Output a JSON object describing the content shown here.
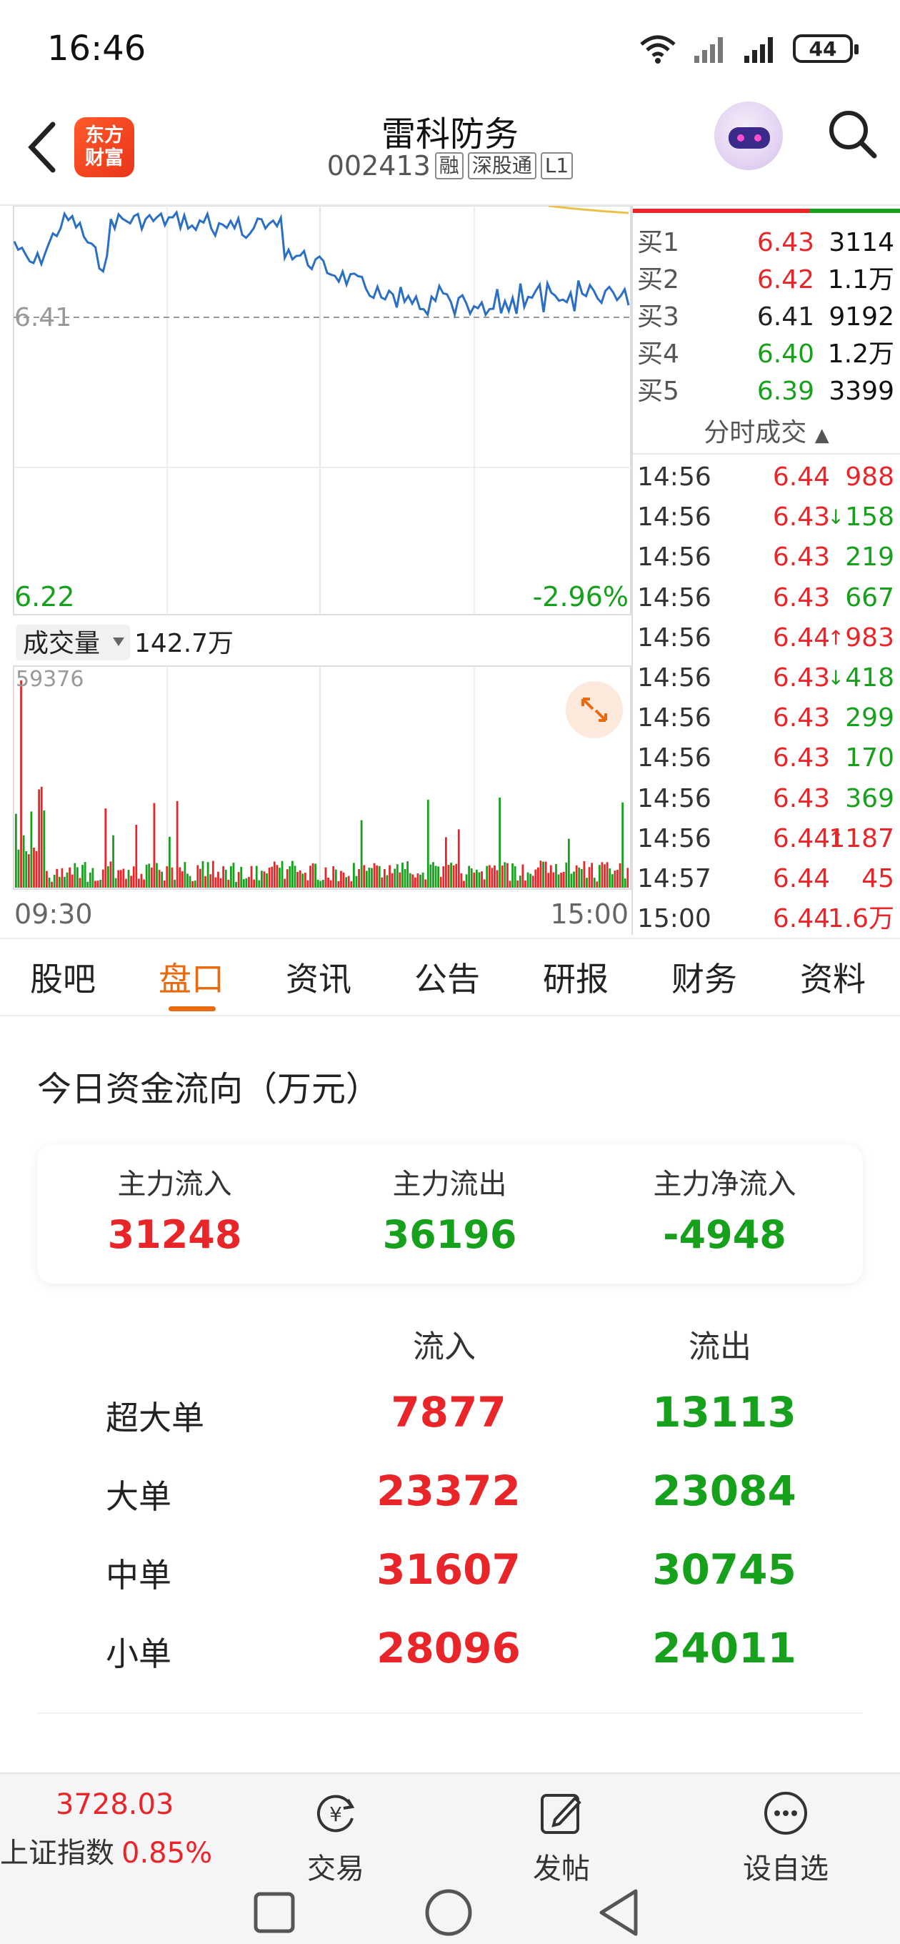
{
  "status_bar": {
    "time": "16:46",
    "battery": "44"
  },
  "header": {
    "logo_line1": "东方",
    "logo_line2": "财富",
    "stock_name": "雷科防务",
    "stock_code": "002413",
    "tags": [
      "融",
      "深股通",
      "L1"
    ]
  },
  "chart": {
    "price_ref": "6.41",
    "price_low": "6.22",
    "pct_low": "-2.96%",
    "volume_selector": "成交量",
    "volume_total": "142.7万",
    "volume_max": "59376",
    "time_start": "09:30",
    "time_end": "15:00"
  },
  "order_book": {
    "bids": [
      {
        "label": "买1",
        "price": "6.43",
        "volume": "3114",
        "color": "red"
      },
      {
        "label": "买2",
        "price": "6.42",
        "volume": "1.1万",
        "color": "red"
      },
      {
        "label": "买3",
        "price": "6.41",
        "volume": "9192",
        "color": "gray"
      },
      {
        "label": "买4",
        "price": "6.40",
        "volume": "1.2万",
        "color": "green"
      },
      {
        "label": "买5",
        "price": "6.39",
        "volume": "3399",
        "color": "green"
      }
    ],
    "trades_header": "分时成交",
    "trades": [
      {
        "time": "14:56",
        "price": "6.44",
        "arrow": "",
        "volume": "988",
        "color": "red"
      },
      {
        "time": "14:56",
        "price": "6.43",
        "arrow": "↓",
        "volume": "158",
        "color": "green"
      },
      {
        "time": "14:56",
        "price": "6.43",
        "arrow": "",
        "volume": "219",
        "color": "green"
      },
      {
        "time": "14:56",
        "price": "6.43",
        "arrow": "",
        "volume": "667",
        "color": "green"
      },
      {
        "time": "14:56",
        "price": "6.44",
        "arrow": "↑",
        "volume": "983",
        "color": "red"
      },
      {
        "time": "14:56",
        "price": "6.43",
        "arrow": "↓",
        "volume": "418",
        "color": "green"
      },
      {
        "time": "14:56",
        "price": "6.43",
        "arrow": "",
        "volume": "299",
        "color": "green"
      },
      {
        "time": "14:56",
        "price": "6.43",
        "arrow": "",
        "volume": "170",
        "color": "green"
      },
      {
        "time": "14:56",
        "price": "6.43",
        "arrow": "",
        "volume": "369",
        "color": "green"
      },
      {
        "time": "14:56",
        "price": "6.44",
        "arrow": "↑",
        "volume": "1187",
        "color": "red"
      },
      {
        "time": "14:57",
        "price": "6.44",
        "arrow": "",
        "volume": "45",
        "color": "red"
      },
      {
        "time": "15:00",
        "price": "6.44",
        "arrow": "",
        "volume": "1.6万",
        "color": "red"
      }
    ]
  },
  "tabs": [
    {
      "label": "股吧",
      "active": false
    },
    {
      "label": "盘口",
      "active": true
    },
    {
      "label": "资讯",
      "active": false
    },
    {
      "label": "公告",
      "active": false
    },
    {
      "label": "研报",
      "active": false
    },
    {
      "label": "财务",
      "active": false
    },
    {
      "label": "资料",
      "active": false
    }
  ],
  "fund_flow": {
    "title": "今日资金流向（万元）",
    "summary": [
      {
        "label": "主力流入",
        "value": "31248",
        "color": "red"
      },
      {
        "label": "主力流出",
        "value": "36196",
        "color": "green"
      },
      {
        "label": "主力净流入",
        "value": "-4948",
        "color": "green"
      }
    ],
    "col_in": "流入",
    "col_out": "流出",
    "rows": [
      {
        "name": "超大单",
        "in": "7877",
        "out": "13113"
      },
      {
        "name": "大单",
        "in": "23372",
        "out": "23084"
      },
      {
        "name": "中单",
        "in": "31607",
        "out": "30745"
      },
      {
        "name": "小单",
        "in": "28096",
        "out": "24011"
      }
    ]
  },
  "bottom_bar": {
    "index_value": "3728.03",
    "index_name": "上证指数",
    "index_pct": "0.85%",
    "trade_label": "交易",
    "post_label": "发帖",
    "watch_label": "设自选"
  },
  "colors": {
    "up": "#e8262a",
    "down": "#16a01c",
    "accent": "#e86b10",
    "line": "#2a6fc4"
  }
}
